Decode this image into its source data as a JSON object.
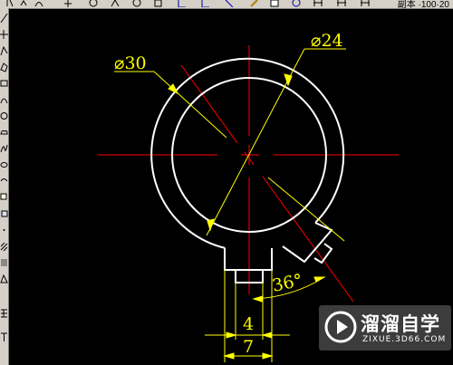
{
  "toolbar": {
    "buttons": [
      "pointer-icon",
      "snap-icon",
      "curve-icon",
      "circle-icon",
      "polygon-icon",
      "zoom-icon",
      "dim-icon",
      "dim2-icon",
      "pencil-icon",
      "sheet-icon",
      "calc-icon",
      "dim-linear-icon",
      "dim-aligned-icon",
      "dim-ordinate-icon"
    ],
    "status_text": "副本 ·100·20"
  },
  "left_toolbar": {
    "tools": [
      "line",
      "construction-line",
      "polyline",
      "polygon",
      "rectangle",
      "arc",
      "circle",
      "cloud",
      "spline",
      "ellipse",
      "ellipse-arc",
      "insert-block",
      "make-block",
      "point",
      "hatch",
      "gradient",
      "region",
      "table",
      "mtext"
    ]
  },
  "drawing": {
    "dim_outer_diameter": "⌀30",
    "dim_inner_diameter": "⌀24",
    "dim_angle": "36°",
    "dim_small_width": "4",
    "dim_large_width": "7",
    "colors": {
      "background": "#000000",
      "geometry": "#ffffff",
      "centerline": "#ff0000",
      "dimension": "#ffff00"
    }
  },
  "watermark": {
    "title": "溜溜自学",
    "url": "ZIXUE.3D66.COM"
  }
}
